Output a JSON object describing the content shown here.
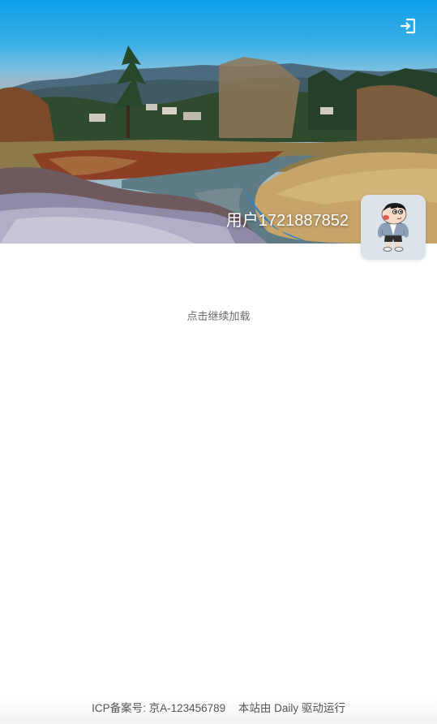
{
  "header": {
    "username": "用户1721887852",
    "login_icon": "login-icon",
    "avatar_icon": "cartoon-boy-avatar"
  },
  "main": {
    "load_more_label": "点击继续加载"
  },
  "footer": {
    "icp": "ICP备案号: 京A-123456789",
    "powered": "本站由 Daily 驱动运行"
  },
  "colors": {
    "sky": "#0ea0e8",
    "username_text": "#ffffff",
    "avatar_bg": "#dde3ea",
    "muted_text": "#6b6b6b"
  }
}
